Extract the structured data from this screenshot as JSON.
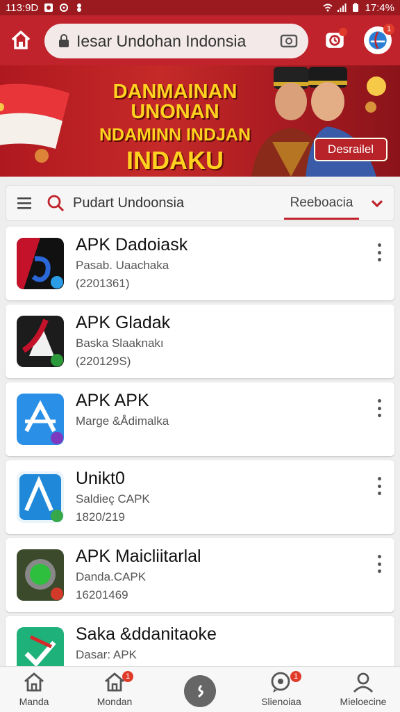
{
  "status_bar": {
    "time": "113:9D",
    "battery_time": "17:4%"
  },
  "url_bar": {
    "text": "Iesar Undohan Indonsia"
  },
  "banner": {
    "line1": "DANMAINAN UNONAN",
    "line2": "NDAMINN INDJAN",
    "line3": "INDAKU",
    "button_label": "Desrailel"
  },
  "filter_bar": {
    "query": "Pudart Undoonsia",
    "sort_label": "Reeboacia"
  },
  "apps": [
    {
      "name": "APK Dadoiask",
      "subtitle": "Pasab. Uaachaka",
      "meta": "(2201361)",
      "has_menu": true
    },
    {
      "name": "APK Gladak",
      "subtitle": "Baska Slaaknakı",
      "meta": "(220129S)",
      "has_menu": false
    },
    {
      "name": "APK APK",
      "subtitle": "Marge &Ådimalka",
      "meta": "",
      "has_menu": true
    },
    {
      "name": "Unikt0",
      "subtitle": "Saldieç CAPK",
      "meta": "1820/219",
      "has_menu": true
    },
    {
      "name": "APK Maicliitarlal",
      "subtitle": "Danda.CAPK",
      "meta": "16201469",
      "has_menu": true
    },
    {
      "name": "Saka &ddanitaoke",
      "subtitle": "Dasar: APK",
      "meta": "",
      "has_menu": false
    }
  ],
  "bottom_nav": [
    {
      "label": "Manda",
      "icon": "home-icon"
    },
    {
      "label": "Mondan",
      "icon": "store-icon",
      "badge": "1"
    },
    {
      "label": "",
      "icon": "center-action-icon"
    },
    {
      "label": "Slienoiaa",
      "icon": "chat-icon",
      "badge": "1"
    },
    {
      "label": "Mieloecine",
      "icon": "profile-icon"
    }
  ],
  "colors": {
    "primary": "#c0232b",
    "banner_text": "#ffd21f"
  }
}
